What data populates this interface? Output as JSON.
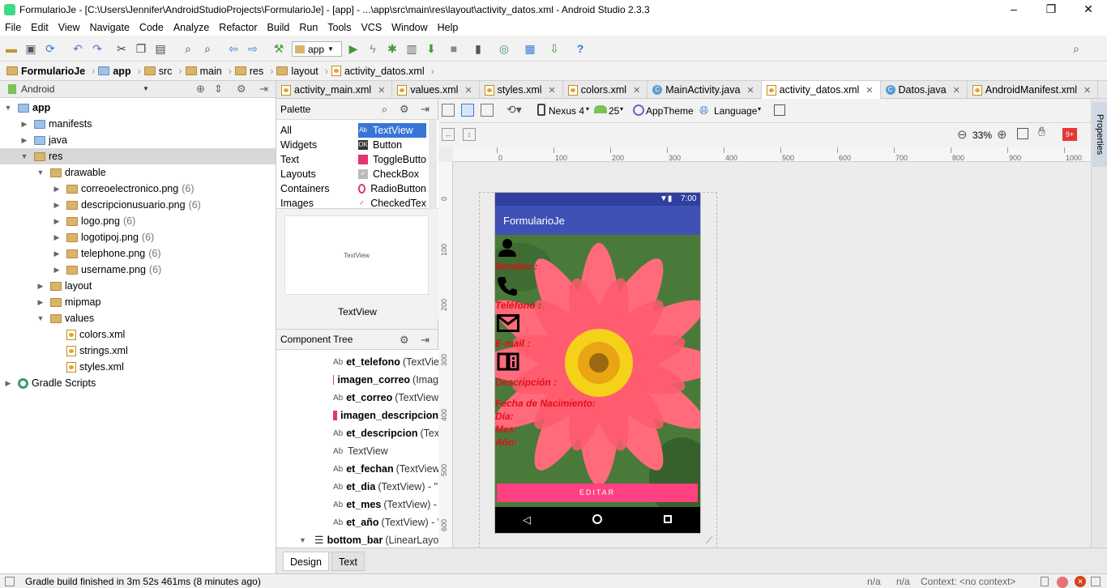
{
  "window": {
    "title": "FormularioJe - [C:\\Users\\Jennifer\\AndroidStudioProjects\\FormularioJe] - [app] - ...\\app\\src\\main\\res\\layout\\activity_datos.xml - Android Studio 2.3.3",
    "min": "–",
    "max": "❐",
    "close": "✕"
  },
  "menu": [
    "File",
    "Edit",
    "View",
    "Navigate",
    "Code",
    "Analyze",
    "Refactor",
    "Build",
    "Run",
    "Tools",
    "VCS",
    "Window",
    "Help"
  ],
  "toolbar": {
    "run_config": "app"
  },
  "breadcrumb": [
    "FormularioJe",
    "app",
    "src",
    "main",
    "res",
    "layout",
    "activity_datos.xml"
  ],
  "project": {
    "view": "Android",
    "tree": [
      {
        "label": "app",
        "level": 0,
        "icon": "folder-blue",
        "expanded": true
      },
      {
        "label": "manifests",
        "level": 1,
        "icon": "folder-blue",
        "expanded": false
      },
      {
        "label": "java",
        "level": 1,
        "icon": "folder-blue",
        "expanded": false
      },
      {
        "label": "res",
        "level": 1,
        "icon": "folder",
        "expanded": true,
        "selected": true
      },
      {
        "label": "drawable",
        "level": 2,
        "icon": "folder",
        "expanded": true
      },
      {
        "label": "correoelectronico.png",
        "count": "(6)",
        "level": 3,
        "icon": "folder",
        "expanded": false
      },
      {
        "label": "descripcionusuario.png",
        "count": "(6)",
        "level": 3,
        "icon": "folder",
        "expanded": false
      },
      {
        "label": "logo.png",
        "count": "(6)",
        "level": 3,
        "icon": "folder",
        "expanded": false
      },
      {
        "label": "logotipoj.png",
        "count": "(6)",
        "level": 3,
        "icon": "folder",
        "expanded": false
      },
      {
        "label": "telephone.png",
        "count": "(6)",
        "level": 3,
        "icon": "folder",
        "expanded": false
      },
      {
        "label": "username.png",
        "count": "(6)",
        "level": 3,
        "icon": "folder",
        "expanded": false
      },
      {
        "label": "layout",
        "level": 2,
        "icon": "folder",
        "expanded": false
      },
      {
        "label": "mipmap",
        "level": 2,
        "icon": "folder",
        "expanded": false
      },
      {
        "label": "values",
        "level": 2,
        "icon": "folder",
        "expanded": true
      },
      {
        "label": "colors.xml",
        "level": 3,
        "icon": "xml"
      },
      {
        "label": "strings.xml",
        "level": 3,
        "icon": "xml"
      },
      {
        "label": "styles.xml",
        "level": 3,
        "icon": "xml"
      },
      {
        "label": "Gradle Scripts",
        "level": 0,
        "icon": "gradle",
        "expanded": false
      }
    ]
  },
  "tabs": [
    {
      "label": "activity_main.xml",
      "icon": "xml"
    },
    {
      "label": "values.xml",
      "icon": "xml"
    },
    {
      "label": "styles.xml",
      "icon": "xml"
    },
    {
      "label": "colors.xml",
      "icon": "xml"
    },
    {
      "label": "MainActivity.java",
      "icon": "class"
    },
    {
      "label": "activity_datos.xml",
      "icon": "xml",
      "active": true
    },
    {
      "label": "Datos.java",
      "icon": "class"
    },
    {
      "label": "AndroidManifest.xml",
      "icon": "xml"
    }
  ],
  "palette": {
    "title": "Palette",
    "categories": [
      "All",
      "Widgets",
      "Text",
      "Layouts",
      "Containers",
      "Images"
    ],
    "items": [
      "TextView",
      "Button",
      "ToggleButto",
      "CheckBox",
      "RadioButton",
      "CheckedTex"
    ],
    "preview": "TextView",
    "preview_caption": "TextView"
  },
  "component_tree": {
    "title": "Component Tree",
    "rows": [
      {
        "id": "et_telefono",
        "type": "(TextView)",
        "icon": "ab"
      },
      {
        "id": "imagen_correo",
        "type": "(Imag",
        "icon": "img"
      },
      {
        "id": "et_correo",
        "type": "(TextView)",
        "icon": "ab"
      },
      {
        "id": "imagen_descripcion",
        "type": "",
        "icon": "img"
      },
      {
        "id": "et_descripcion",
        "type": "(TextV",
        "icon": "ab"
      },
      {
        "id": "",
        "type": "TextView",
        "icon": "ab"
      },
      {
        "id": "et_fechan",
        "type": "(TextView)",
        "icon": "ab"
      },
      {
        "id": "et_dia",
        "type": "(TextView) - \"@",
        "icon": "ab"
      },
      {
        "id": "et_mes",
        "type": "(TextView) - \"",
        "icon": "ab"
      },
      {
        "id": "et_año",
        "type": "(TextView) - \"",
        "icon": "ab"
      },
      {
        "id": "bottom_bar",
        "type": "(LinearLayou",
        "icon": "layout"
      }
    ]
  },
  "design_toolbar": {
    "device": "Nexus 4",
    "api": "25",
    "theme": "AppTheme",
    "language": "Language",
    "zoom": "33%",
    "badge": "9+"
  },
  "ruler": {
    "h": [
      "0",
      "100",
      "200",
      "300",
      "400",
      "500",
      "600",
      "700",
      "800",
      "900",
      "1000"
    ],
    "v": [
      "0",
      "100",
      "200",
      "300",
      "400",
      "500",
      "600"
    ]
  },
  "preview": {
    "time": "7:00",
    "app_title": "FormularioJe",
    "fields": [
      "Nombre :",
      "Teléfono :",
      "E-mail :",
      "Descripción :"
    ],
    "fecha": "Fecha de Nacimiento:",
    "dia": "Día:",
    "mes": "Mes:",
    "anio": "Año:",
    "button": "EDITAR"
  },
  "bottom_tabs": [
    "Design",
    "Text"
  ],
  "right_strip": "Properties",
  "status": {
    "message": "Gradle build finished in 3m 52s 461ms (8 minutes ago)",
    "na": "n/a",
    "na2": "n/a",
    "context": "Context: <no context>"
  },
  "colors": {
    "accent": "#ff4081",
    "primary": "#3f51b5",
    "primary_dark": "#303f9f",
    "label_red": "#e0101a"
  }
}
